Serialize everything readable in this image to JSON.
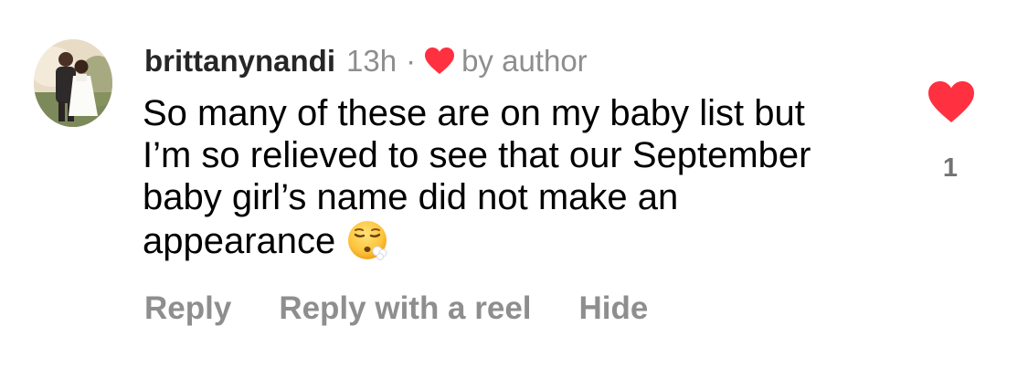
{
  "comment": {
    "username": "brittanynandi",
    "time": "13h",
    "separator": "·",
    "author_badge": {
      "icon": "heart-icon",
      "label": "by author",
      "color": "#ff3040"
    },
    "text_lines": [
      "So many of these are on my baby list but",
      "I’m so relieved to see that our September",
      "baby girl’s name did not make an",
      "appearance"
    ],
    "emoji": "face-exhaling-emoji",
    "like": {
      "icon": "heart-icon",
      "liked": true,
      "color": "#ff3040",
      "count": "1"
    },
    "actions": {
      "reply": "Reply",
      "reply_with_reel": "Reply with a reel",
      "hide": "Hide"
    }
  }
}
